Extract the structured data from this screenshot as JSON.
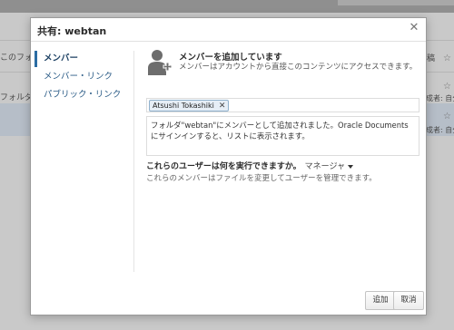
{
  "background": {
    "fragments": {
      "left_1": "このフォ",
      "left_2": "フォルダー",
      "right_1": "稿",
      "right_2a": "成者: 自分",
      "right_2b": "新者: 自分",
      "right_3": "成者: 自分"
    },
    "star": "☆"
  },
  "dialog": {
    "title": "共有: webtan",
    "close_icon": "close-icon",
    "nav": {
      "items": [
        {
          "label": "メンバー",
          "active": true
        },
        {
          "label": "メンバー・リンク",
          "active": false
        },
        {
          "label": "パブリック・リンク",
          "active": false
        }
      ]
    },
    "header": {
      "icon": "add-user-icon",
      "title": "メンバーを追加しています",
      "subtitle": "メンバーはアカウントから直接このコンテンツにアクセスできます。"
    },
    "members": {
      "chips": [
        {
          "label": "Atsushi Tokashiki",
          "remove_icon": "remove-icon"
        }
      ]
    },
    "message": "フォルダ\"webtan\"にメンバーとして追加されました。Oracle Documentsにサインインすると、リストに表示されます。",
    "permission": {
      "question": "これらのユーザーは何を実行できますか。",
      "role": "マネージャ",
      "description": "これらのメンバーはファイルを変更してユーザーを管理できます。"
    },
    "buttons": {
      "add": "追加",
      "cancel": "取消"
    }
  },
  "colors": {
    "accent": "#2b6ca3",
    "link": "#2a5b86"
  }
}
